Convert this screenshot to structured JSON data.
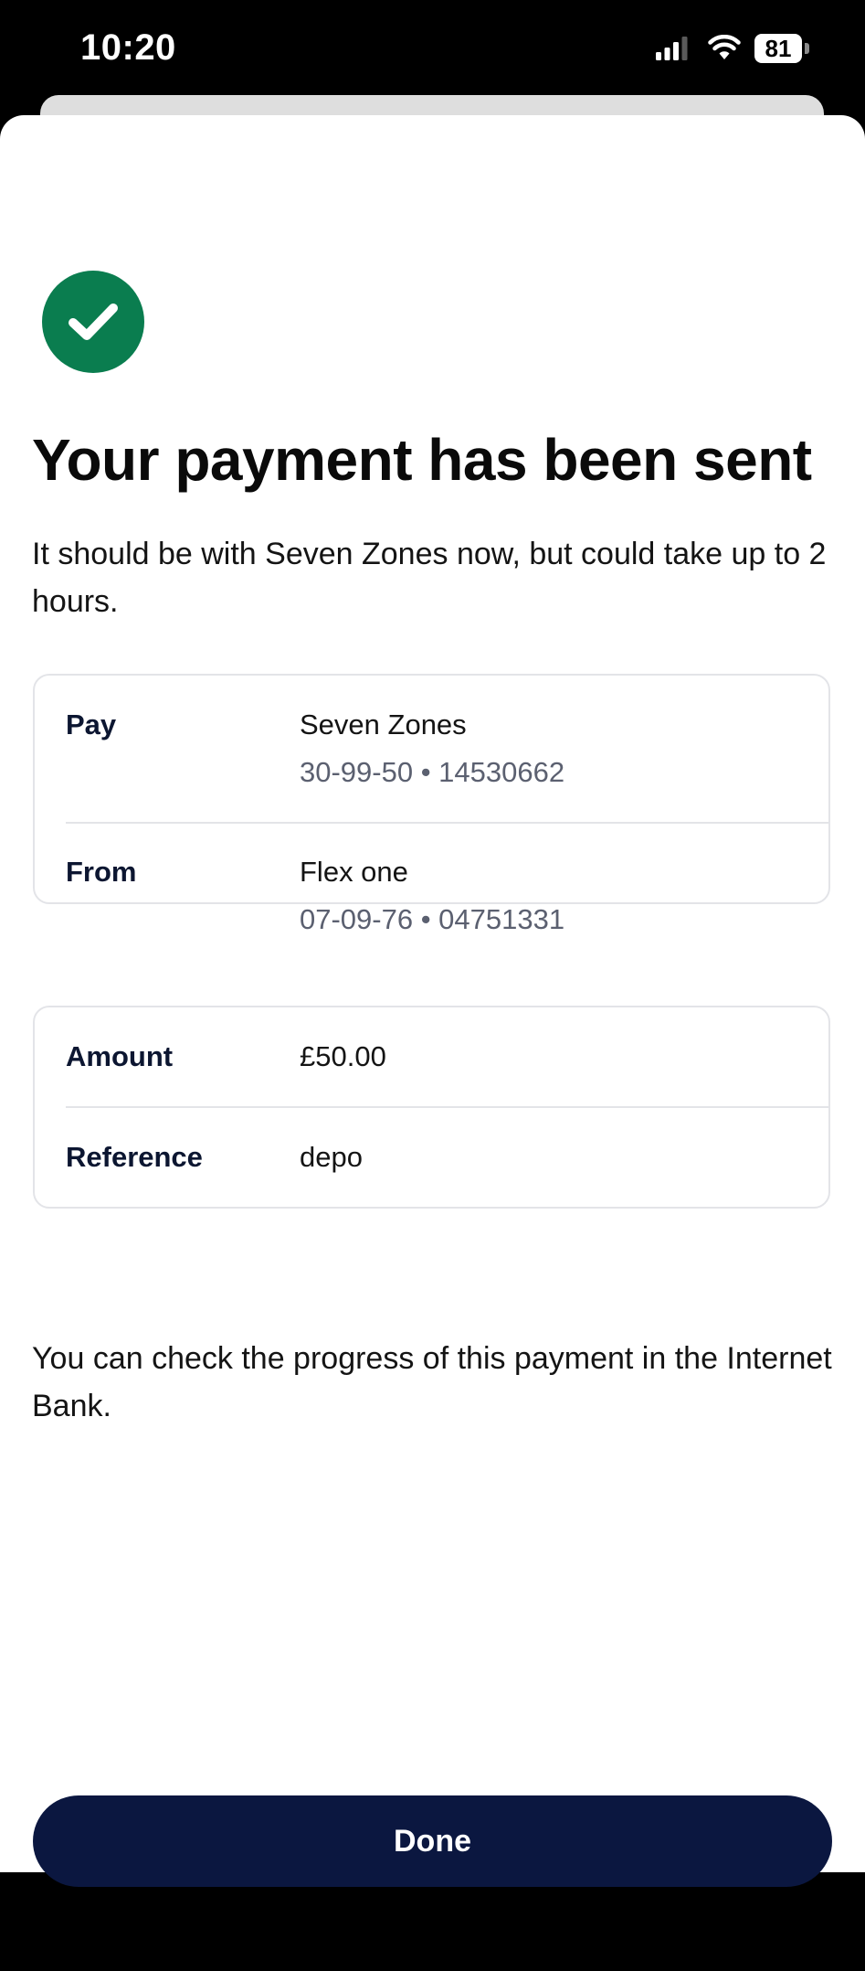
{
  "status_bar": {
    "time": "10:20",
    "battery_level": "81",
    "icons": [
      "signal-icon",
      "wifi-icon",
      "battery-icon"
    ]
  },
  "confirmation": {
    "icon": "checkmark-icon",
    "title": "Your payment has been sent",
    "subtitle": "It should be with Seven  Zones now, but could take up to 2 hours."
  },
  "details_card": {
    "pay": {
      "label": "Pay",
      "name": "Seven  Zones",
      "account": "30-99-50 • 14530662"
    },
    "from": {
      "label": "From",
      "name": "Flex one",
      "account": "07-09-76 • 04751331"
    }
  },
  "amount_card": {
    "amount": {
      "label": "Amount",
      "value": "£50.00"
    },
    "reference": {
      "label": "Reference",
      "value": "depo"
    }
  },
  "footer_note": "You can check the progress of this payment in the Internet Bank.",
  "done_button_label": "Done",
  "colors": {
    "success_green": "#0a7d4f",
    "button_navy": "#0b1740",
    "label_navy": "#0c1631",
    "secondary_gray": "#5b6070",
    "card_border": "#e3e4e8"
  }
}
